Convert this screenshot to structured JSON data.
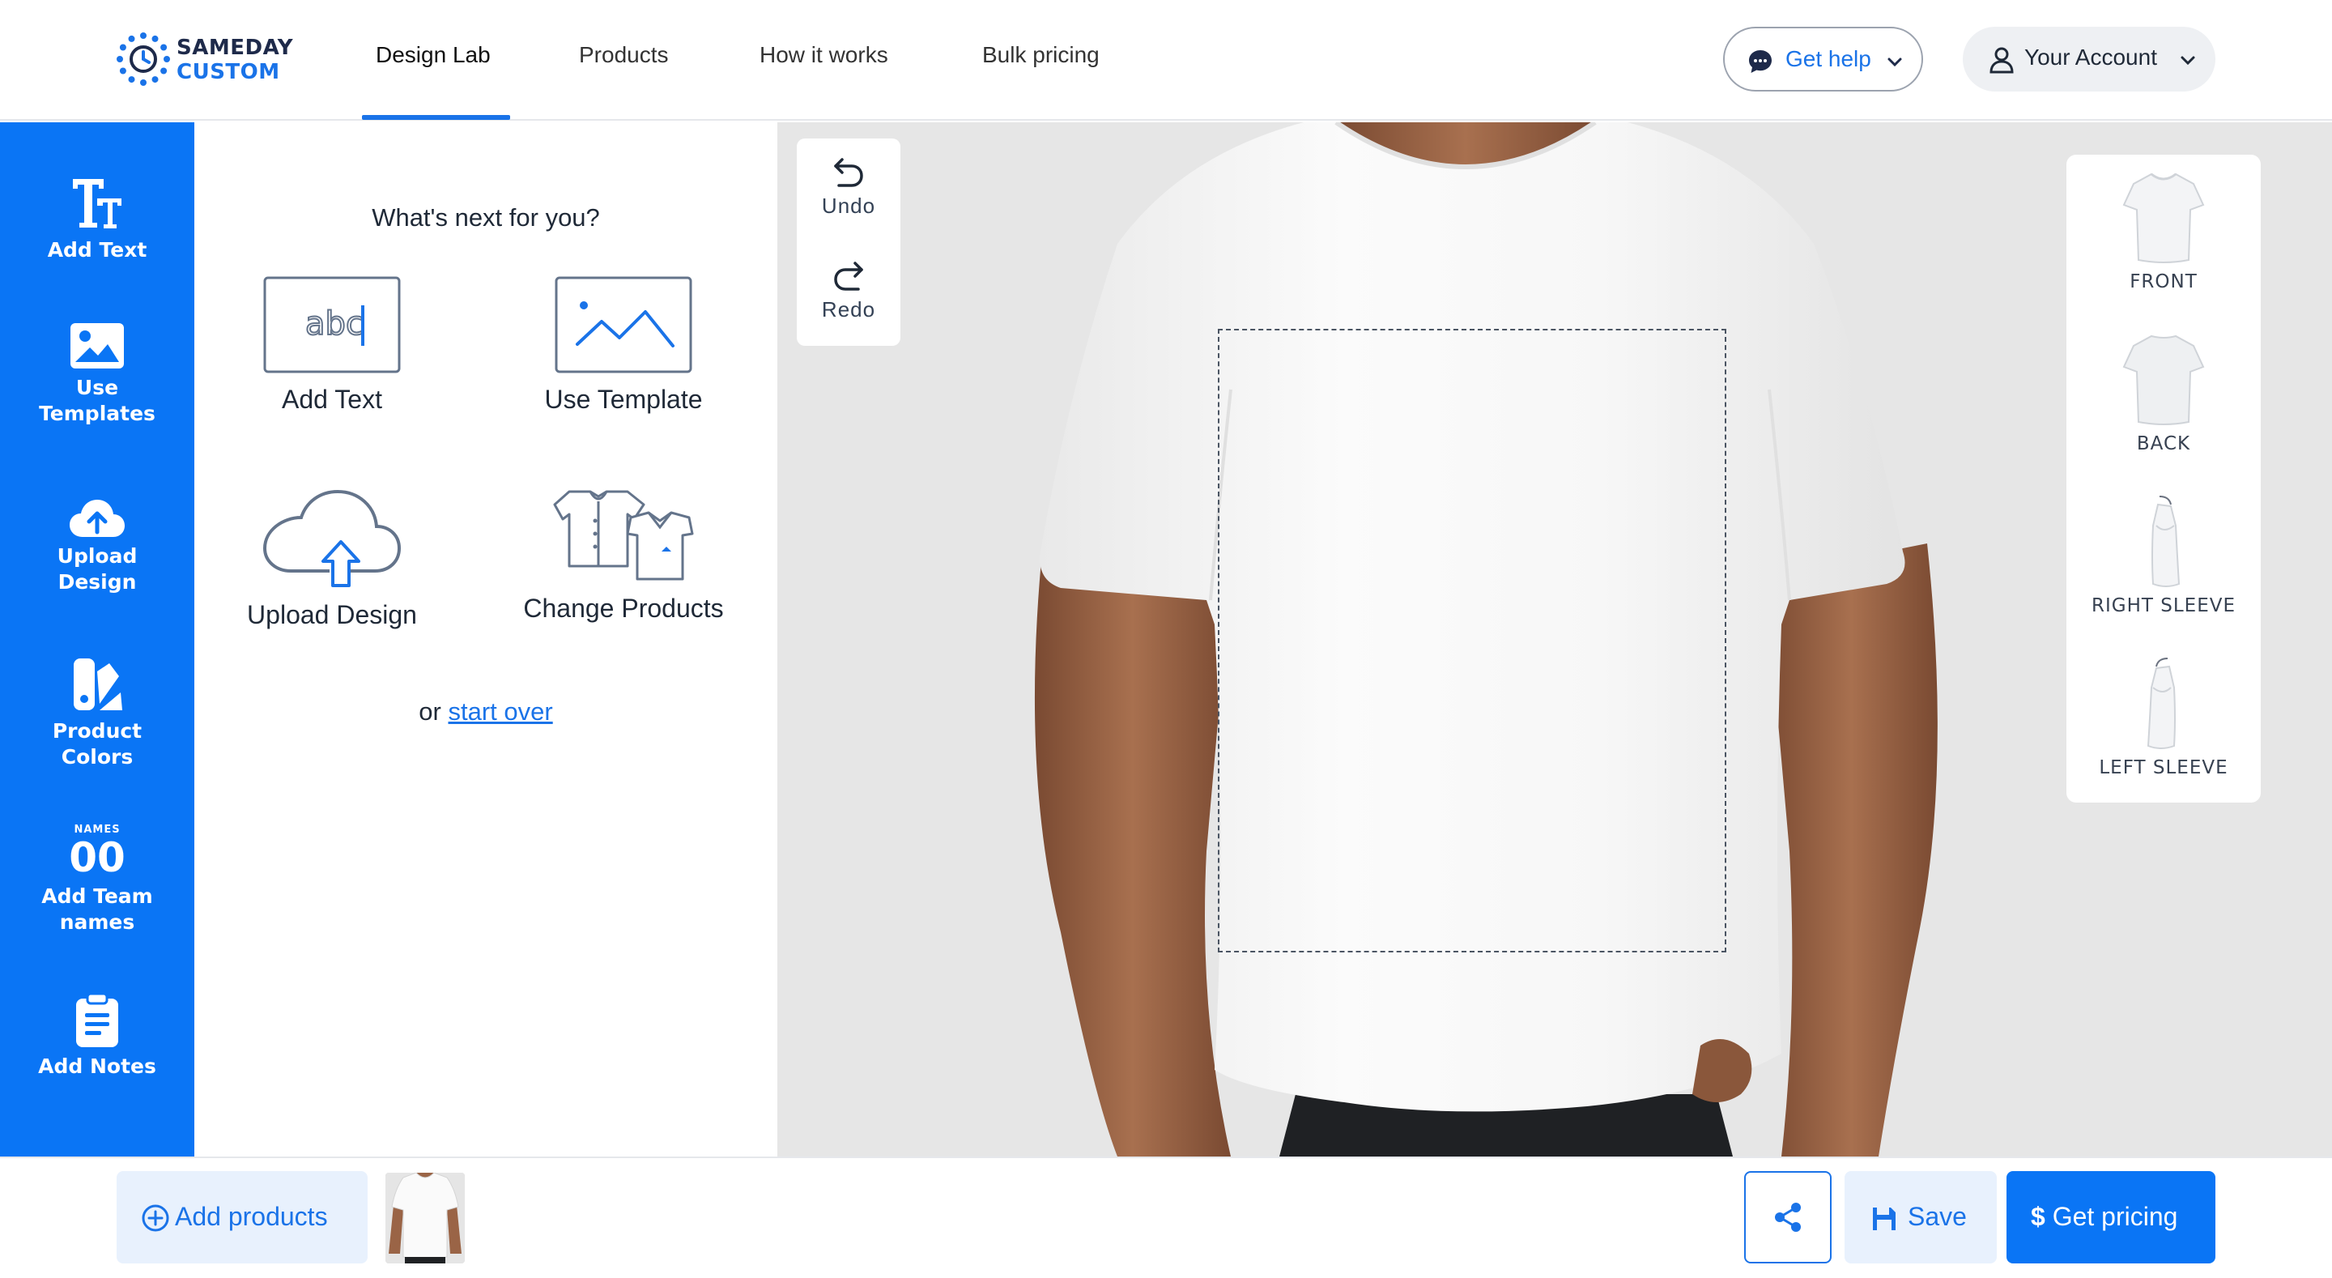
{
  "brand": {
    "line1": "SAMEDAY",
    "line2": "CUSTOM"
  },
  "nav": {
    "items": [
      "Design Lab",
      "Products",
      "How it works",
      "Bulk pricing"
    ],
    "active": "Design Lab"
  },
  "header": {
    "help_label": "Get help",
    "account_label": "Your Account"
  },
  "sidebar": {
    "items": [
      {
        "label_line1": "Add Text",
        "label_line2": "",
        "icon": "add-text-icon"
      },
      {
        "label_line1": "Use",
        "label_line2": "Templates",
        "icon": "image-icon"
      },
      {
        "label_line1": "Upload",
        "label_line2": "Design",
        "icon": "cloud-upload-icon"
      },
      {
        "label_line1": "Product",
        "label_line2": "Colors",
        "icon": "color-swatch-icon"
      },
      {
        "label_line1": "Add Team",
        "label_line2": "names",
        "icon": "team-names-icon",
        "icon_text_top": "NAMES",
        "icon_text_num": "00"
      },
      {
        "label_line1": "Add Notes",
        "label_line2": "",
        "icon": "clipboard-icon"
      }
    ]
  },
  "next_panel": {
    "title": "What's next for you?",
    "options": [
      {
        "label": "Add Text",
        "icon": "abc-text-icon",
        "icon_text": "abc"
      },
      {
        "label": "Use Template",
        "icon": "template-image-icon"
      },
      {
        "label": "Upload Design",
        "icon": "cloud-upload-outline-icon"
      },
      {
        "label": "Change Products",
        "icon": "shirts-icon"
      }
    ],
    "start_over_prefix": "or",
    "start_over_link": "start over"
  },
  "canvas": {
    "undo_label": "Undo",
    "redo_label": "Redo",
    "views": [
      "FRONT",
      "BACK",
      "RIGHT SLEEVE",
      "LEFT SLEEVE"
    ]
  },
  "footer": {
    "add_products_label": "Add products",
    "save_label": "Save",
    "get_pricing_label": "Get pricing"
  },
  "colors": {
    "accent": "#1a73e8",
    "sidebar": "#0a75f5",
    "canvas_bg": "#e6e6e6"
  }
}
